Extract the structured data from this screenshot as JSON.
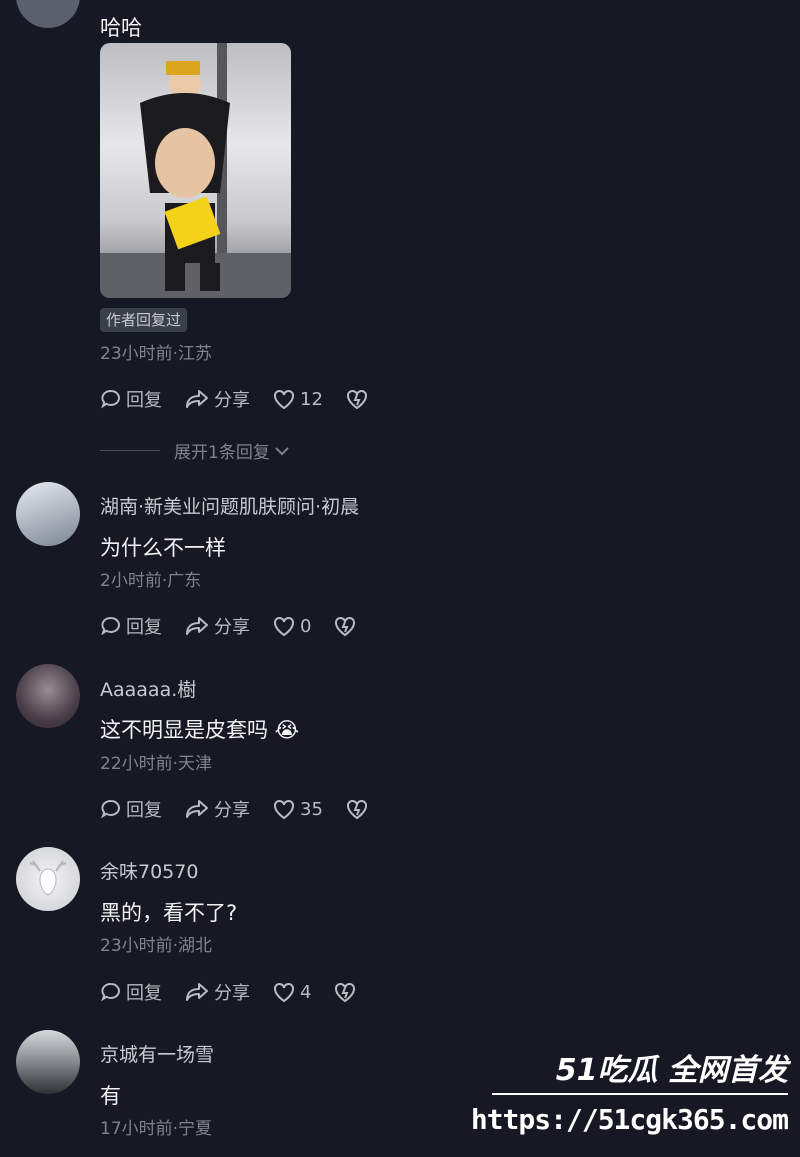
{
  "comments": [
    {
      "text": "哈哈",
      "badge": "作者回复过",
      "meta": "23小时前·江苏",
      "reply": "回复",
      "share": "分享",
      "likes": "12",
      "expand": "展开1条回复"
    },
    {
      "name": "湖南·新美业问题肌肤顾问·初晨",
      "text": "为什么不一样",
      "meta": "2小时前·广东",
      "reply": "回复",
      "share": "分享",
      "likes": "0"
    },
    {
      "name": "Aaaaaa.樹",
      "text": "这不明显是皮套吗 😭",
      "meta": "22小时前·天津",
      "reply": "回复",
      "share": "分享",
      "likes": "35"
    },
    {
      "name": "余味70570",
      "text": "黑的，看不了?",
      "meta": "23小时前·湖北",
      "reply": "回复",
      "share": "分享",
      "likes": "4"
    },
    {
      "name": "京城有一场雪",
      "text": "有",
      "meta": "17小时前·宁夏"
    }
  ],
  "watermark": {
    "title": "51吃瓜 全网首发",
    "url": "https://51cgk365.com"
  },
  "icons": [
    "reply-icon",
    "share-icon",
    "heart-icon",
    "dislike-icon",
    "chevron-down-icon"
  ]
}
